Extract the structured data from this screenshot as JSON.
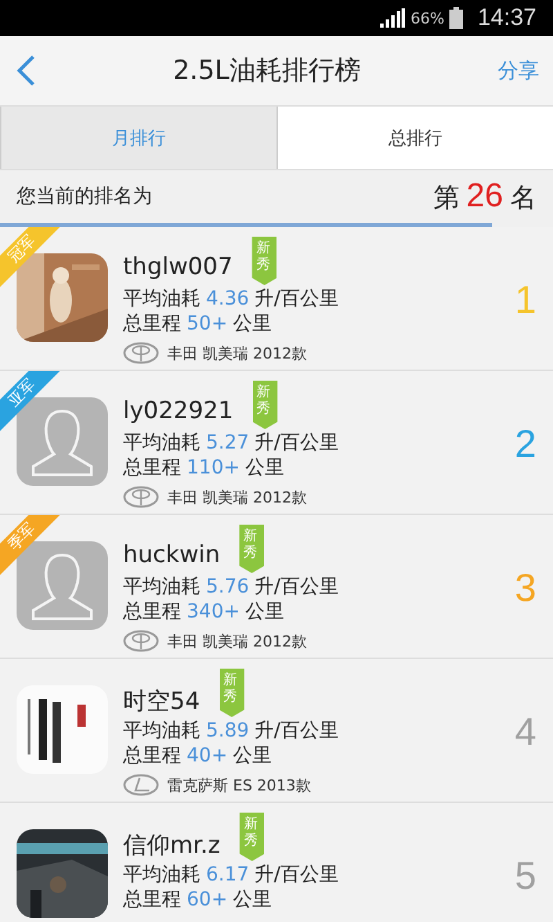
{
  "status_bar": {
    "battery": "66%",
    "time": "14:37"
  },
  "header": {
    "title": "2.5L油耗排行榜",
    "action": "分享"
  },
  "tabs": [
    {
      "label": "月排行",
      "selected": true
    },
    {
      "label": "总排行",
      "selected": false
    }
  ],
  "my_rank": {
    "label": "您当前的排名为",
    "prefix": "第",
    "rank": "26",
    "suffix": "名",
    "level": 0.89
  },
  "rows": [
    {
      "ribbon": "冠军",
      "color": "#f5c42c",
      "name": "thglw007",
      "badge": "新秀",
      "fuel_label": "平均油耗",
      "fuel": "4.36",
      "fuel_unit": "升/百公里",
      "distance_label": "总里程",
      "distance": "50+",
      "distance_unit": "公里",
      "logo": {
        "kind": "oval"
      },
      "car": "丰田 凯美瑞 2012款",
      "rank": "1"
    },
    {
      "ribbon": "亚军",
      "color": "#2aa3e0",
      "avatar": {
        "kind": "silhouette"
      },
      "name": "ly022921",
      "badge": "新秀",
      "fuel_label": "平均油耗",
      "fuel": "5.27",
      "fuel_unit": "升/百公里",
      "distance_label": "总里程",
      "distance": "110+",
      "distance_unit": "公里",
      "logo": {
        "kind": "oval"
      },
      "car": "丰田 凯美瑞 2012款",
      "rank": "2"
    },
    {
      "ribbon": "季军",
      "color": "#f5a623",
      "avatar": {
        "kind": "silhouette"
      },
      "name": "huckwin",
      "badge": "新秀",
      "fuel_label": "平均油耗",
      "fuel": "5.76",
      "fuel_unit": "升/百公里",
      "distance_label": "总里程",
      "distance": "340+",
      "distance_unit": "公里",
      "logo": {
        "kind": "oval"
      },
      "car": "丰田 凯美瑞 2012款",
      "rank": "3"
    },
    {
      "color": "#a0a0a0",
      "name": "时空54",
      "badge": "新秀",
      "fuel_label": "平均油耗",
      "fuel": "5.89",
      "fuel_unit": "升/百公里",
      "distance_label": "总里程",
      "distance": "40+",
      "distance_unit": "公里",
      "logo": {
        "kind": "letter"
      },
      "car": "雷克萨斯 ES 2013款",
      "rank": "4"
    },
    {
      "color": "#a0a0a0",
      "name": "信仰mr.z",
      "badge": "新秀",
      "fuel_label": "平均油耗",
      "fuel": "6.17",
      "fuel_unit": "升/百公里",
      "distance_label": "总里程",
      "distance": "60+",
      "distance_unit": "公里",
      "rank": "5"
    }
  ]
}
